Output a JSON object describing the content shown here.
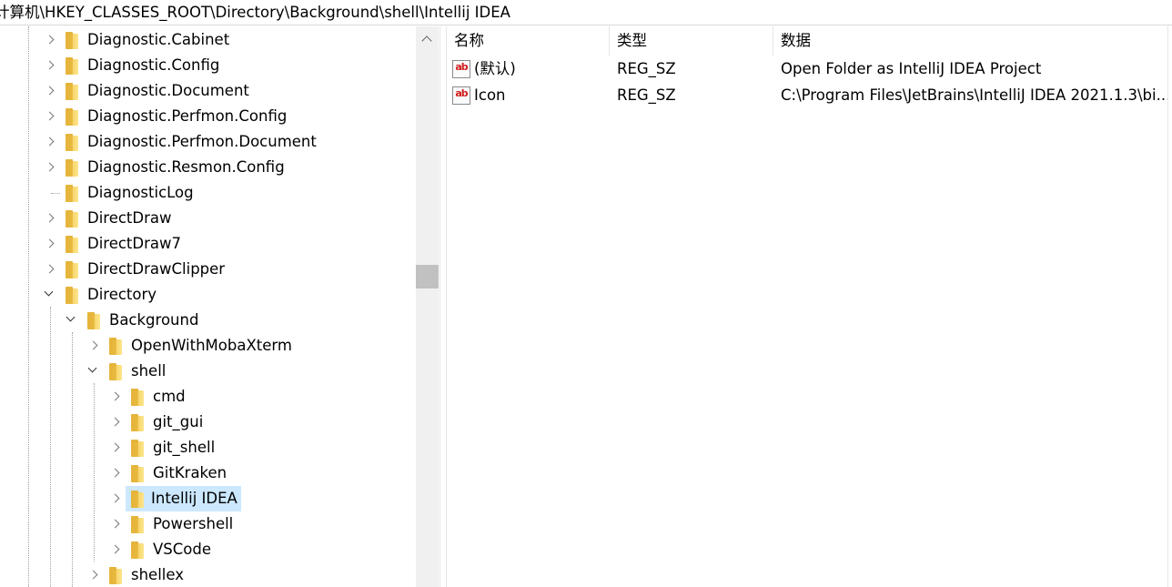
{
  "address_bar": {
    "path": "计算机\\HKEY_CLASSES_ROOT\\Directory\\Background\\shell\\Intellij IDEA"
  },
  "tree": {
    "items": [
      {
        "label": "Diagnostic.Cabinet",
        "expander": "right"
      },
      {
        "label": "Diagnostic.Config",
        "expander": "right"
      },
      {
        "label": "Diagnostic.Document",
        "expander": "right"
      },
      {
        "label": "Diagnostic.Perfmon.Config",
        "expander": "right"
      },
      {
        "label": "Diagnostic.Perfmon.Document",
        "expander": "right"
      },
      {
        "label": "Diagnostic.Resmon.Config",
        "expander": "right"
      },
      {
        "label": "DiagnosticLog",
        "expander": "none"
      },
      {
        "label": "DirectDraw",
        "expander": "right"
      },
      {
        "label": "DirectDraw7",
        "expander": "right"
      },
      {
        "label": "DirectDrawClipper",
        "expander": "right"
      },
      {
        "label": "Directory",
        "expander": "down"
      },
      {
        "label": "Background",
        "expander": "down"
      },
      {
        "label": "OpenWithMobaXterm",
        "expander": "right"
      },
      {
        "label": "shell",
        "expander": "down"
      },
      {
        "label": "cmd",
        "expander": "right"
      },
      {
        "label": "git_gui",
        "expander": "right"
      },
      {
        "label": "git_shell",
        "expander": "right"
      },
      {
        "label": "GitKraken",
        "expander": "right"
      },
      {
        "label": "Intellij IDEA",
        "expander": "right",
        "selected": true
      },
      {
        "label": "Powershell",
        "expander": "right"
      },
      {
        "label": "VSCode",
        "expander": "right"
      },
      {
        "label": "shellex",
        "expander": "right"
      }
    ]
  },
  "values_table": {
    "columns": [
      "名称",
      "类型",
      "数据"
    ],
    "rows": [
      {
        "name": "(默认)",
        "type": "REG_SZ",
        "data": "Open Folder as IntelliJ IDEA Project",
        "icon": "string-value-icon"
      },
      {
        "name": "Icon",
        "type": "REG_SZ",
        "data": "C:\\Program Files\\JetBrains\\IntelliJ IDEA 2021.1.3\\bi...",
        "icon": "string-value-icon"
      }
    ],
    "icon_glyph": "ab"
  },
  "colors": {
    "selection": "#cce8ff",
    "folder": "#e8b93f",
    "icon_text": "#d11a1a"
  }
}
